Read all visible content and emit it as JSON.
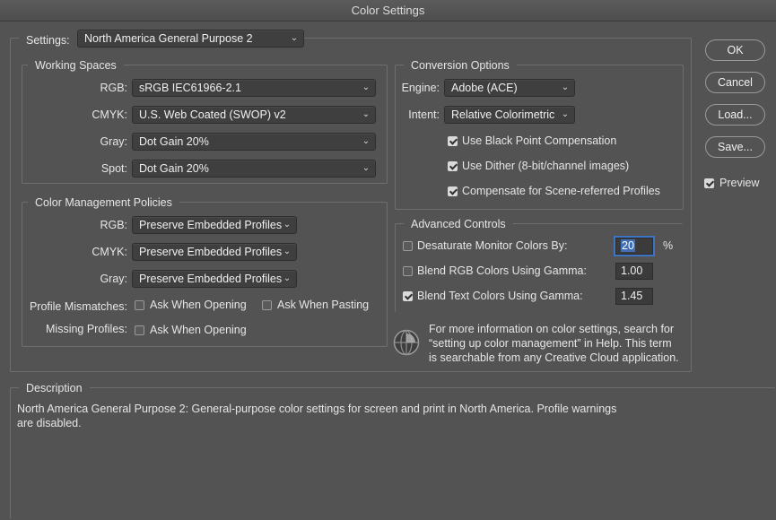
{
  "window": {
    "title": "Color Settings"
  },
  "settings": {
    "label": "Settings:",
    "value": "North America General Purpose 2"
  },
  "working_spaces": {
    "title": "Working Spaces",
    "rgb": {
      "label": "RGB:",
      "value": "sRGB IEC61966-2.1"
    },
    "cmyk": {
      "label": "CMYK:",
      "value": "U.S. Web Coated (SWOP) v2"
    },
    "gray": {
      "label": "Gray:",
      "value": "Dot Gain 20%"
    },
    "spot": {
      "label": "Spot:",
      "value": "Dot Gain 20%"
    }
  },
  "policies": {
    "title": "Color Management Policies",
    "rgb": {
      "label": "RGB:",
      "value": "Preserve Embedded Profiles"
    },
    "cmyk": {
      "label": "CMYK:",
      "value": "Preserve Embedded Profiles"
    },
    "gray": {
      "label": "Gray:",
      "value": "Preserve Embedded Profiles"
    },
    "mismatch": {
      "label": "Profile Mismatches:",
      "ask_opening": {
        "label": "Ask When Opening",
        "checked": false
      },
      "ask_pasting": {
        "label": "Ask When Pasting",
        "checked": false
      }
    },
    "missing": {
      "label": "Missing Profiles:",
      "ask_opening": {
        "label": "Ask When Opening",
        "checked": false
      }
    }
  },
  "conversion": {
    "title": "Conversion Options",
    "engine": {
      "label": "Engine:",
      "value": "Adobe (ACE)"
    },
    "intent": {
      "label": "Intent:",
      "value": "Relative Colorimetric"
    },
    "black_point": {
      "label": "Use Black Point Compensation",
      "checked": true
    },
    "dither": {
      "label": "Use Dither (8-bit/channel images)",
      "checked": true
    },
    "scene_referred": {
      "label": "Compensate for Scene-referred Profiles",
      "checked": true
    }
  },
  "advanced": {
    "title": "Advanced Controls",
    "desaturate": {
      "label": "Desaturate Monitor Colors By:",
      "checked": false,
      "value": "20",
      "unit": "%"
    },
    "blend_rgb": {
      "label": "Blend RGB Colors Using Gamma:",
      "checked": false,
      "value": "1.00"
    },
    "blend_text": {
      "label": "Blend Text Colors Using Gamma:",
      "checked": true,
      "value": "1.45"
    }
  },
  "info": {
    "line1": "For more information on color settings, search for",
    "line2": "“setting up color management” in Help. This term",
    "line3": "is searchable from any Creative Cloud application."
  },
  "description": {
    "title": "Description",
    "line1": "North America General Purpose 2:  General-purpose color settings for screen and print in North America. Profile warnings",
    "line2": "are disabled."
  },
  "buttons": {
    "ok": "OK",
    "cancel": "Cancel",
    "load": "Load...",
    "save": "Save..."
  },
  "preview": {
    "label": "Preview",
    "checked": true
  },
  "colors": {
    "background": "#535353",
    "accent": "#3e6fb7"
  },
  "icons": {
    "chevron": "chevron-down-icon",
    "info": "color-management-globe-icon"
  }
}
